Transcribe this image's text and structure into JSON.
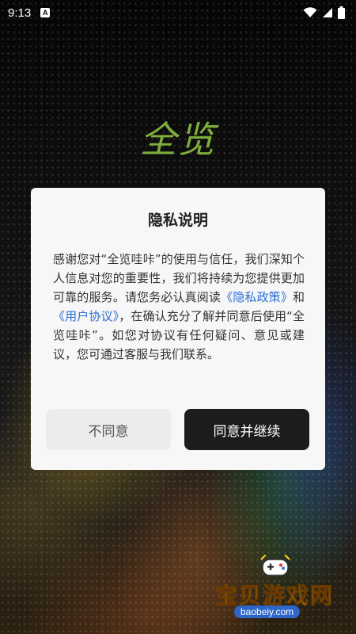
{
  "status_bar": {
    "time": "9:13",
    "notification_icon": "A"
  },
  "app": {
    "logo_text": "全览"
  },
  "dialog": {
    "title": "隐私说明",
    "body_part1": "感谢您对“全览哇咔”的使用与信任，我们深知个人信息对您的重要性，我们将持续为您提供更加可靠的服务。请您务必认真阅读",
    "privacy_link": "《隐私政策》",
    "and": "和",
    "user_link": "《用户协议》",
    "body_part2": "，在确认充分了解并同意后使用“全览哇咔”。如您对协议有任何疑问、意见或建议，您可通过客服与我们联系。",
    "disagree_label": "不同意",
    "agree_label": "同意并继续"
  },
  "watermark": {
    "text": "宝贝游戏网",
    "url": "baobeiy.com"
  }
}
